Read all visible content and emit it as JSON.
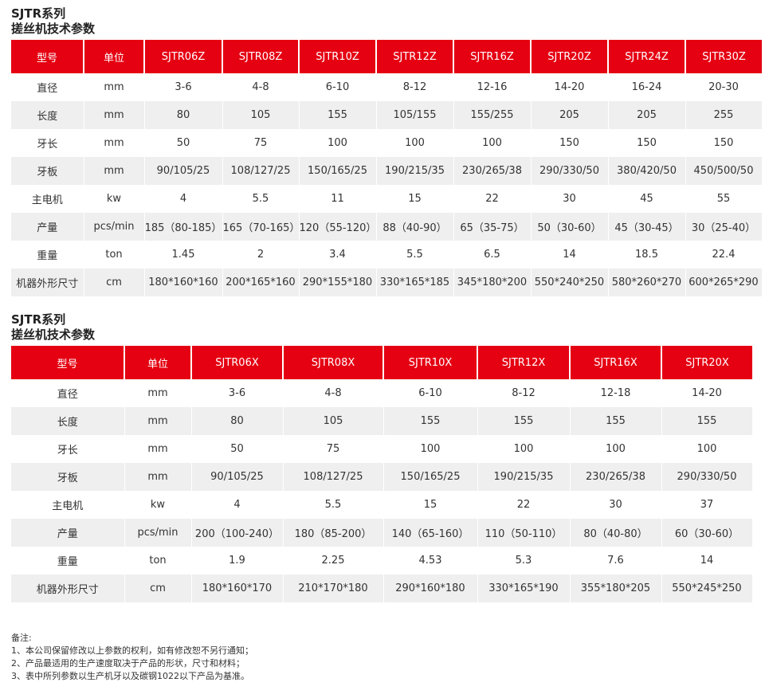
{
  "section1": {
    "title_line1": "SJTR系列",
    "title_line2": "搓丝机技术参数",
    "headers": [
      "型号",
      "单位",
      "SJTR06Z",
      "SJTR08Z",
      "SJTR10Z",
      "SJTR12Z",
      "SJTR16Z",
      "SJTR20Z",
      "SJTR24Z",
      "SJTR30Z"
    ],
    "rows": [
      [
        "直径",
        "mm",
        "3-6",
        "4-8",
        "6-10",
        "8-12",
        "12-16",
        "14-20",
        "16-24",
        "20-30"
      ],
      [
        "长度",
        "mm",
        "80",
        "105",
        "155",
        "105/155",
        "155/255",
        "205",
        "205",
        "255"
      ],
      [
        "牙长",
        "mm",
        "50",
        "75",
        "100",
        "100",
        "100",
        "150",
        "150",
        "150"
      ],
      [
        "牙板",
        "mm",
        "90/105/25",
        "108/127/25",
        "150/165/25",
        "190/215/35",
        "230/265/38",
        "290/330/50",
        "380/420/50",
        "450/500/50"
      ],
      [
        "主电机",
        "kw",
        "4",
        "5.5",
        "11",
        "15",
        "22",
        "30",
        "45",
        "55"
      ],
      [
        "产量",
        "pcs/min",
        "185（80-185）",
        "165（70-165）",
        "120（55-120）",
        "88（40-90）",
        "65（35-75）",
        "50（30-60）",
        "45（30-45）",
        "30（25-40）"
      ],
      [
        "重量",
        "ton",
        "1.45",
        "2",
        "3.4",
        "5.5",
        "6.5",
        "14",
        "18.5",
        "22.4"
      ],
      [
        "机器外形尺寸",
        "cm",
        "180*160*160",
        "200*165*160",
        "290*155*180",
        "330*165*185",
        "345*180*200",
        "550*240*250",
        "580*260*270",
        "600*265*290"
      ]
    ]
  },
  "section2": {
    "title_line1": "SJTR系列",
    "title_line2": "搓丝机技术参数",
    "headers": [
      "型号",
      "单位",
      "SJTR06X",
      "SJTR08X",
      "SJTR10X",
      "SJTR12X",
      "SJTR16X",
      "SJTR20X"
    ],
    "rows": [
      [
        "直径",
        "mm",
        "3-6",
        "4-8",
        "6-10",
        "8-12",
        "12-18",
        "14-20"
      ],
      [
        "长度",
        "mm",
        "80",
        "105",
        "155",
        "155",
        "155",
        "155"
      ],
      [
        "牙长",
        "mm",
        "50",
        "75",
        "100",
        "100",
        "100",
        "100"
      ],
      [
        "牙板",
        "mm",
        "90/105/25",
        "108/127/25",
        "150/165/25",
        "190/215/35",
        "230/265/38",
        "290/330/50"
      ],
      [
        "主电机",
        "kw",
        "4",
        "5.5",
        "15",
        "22",
        "30",
        "37"
      ],
      [
        "产量",
        "pcs/min",
        "200（100-240）",
        "180（85-200）",
        "140（65-160）",
        "110（50-110）",
        "80（40-80）",
        "60（30-60）"
      ],
      [
        "重量",
        "ton",
        "1.9",
        "2.25",
        "4.53",
        "5.3",
        "7.6",
        "14"
      ],
      [
        "机器外形尺寸",
        "cm",
        "180*160*170",
        "210*170*180",
        "290*160*180",
        "330*165*190",
        "355*180*205",
        "550*245*250"
      ]
    ]
  },
  "notes": {
    "heading": "备注:",
    "items": [
      "1、本公司保留修改以上参数的权利，如有修改恕不另行通知；",
      "2、产品最适用的生产速度取决于产品的形状，尺寸和材料；",
      "3、表中所列参数以生产机牙以及碳钢1022以下产品为基准。"
    ]
  },
  "colors": {
    "header_bg": "#e50012",
    "alt_row_bg": "#efefef"
  }
}
